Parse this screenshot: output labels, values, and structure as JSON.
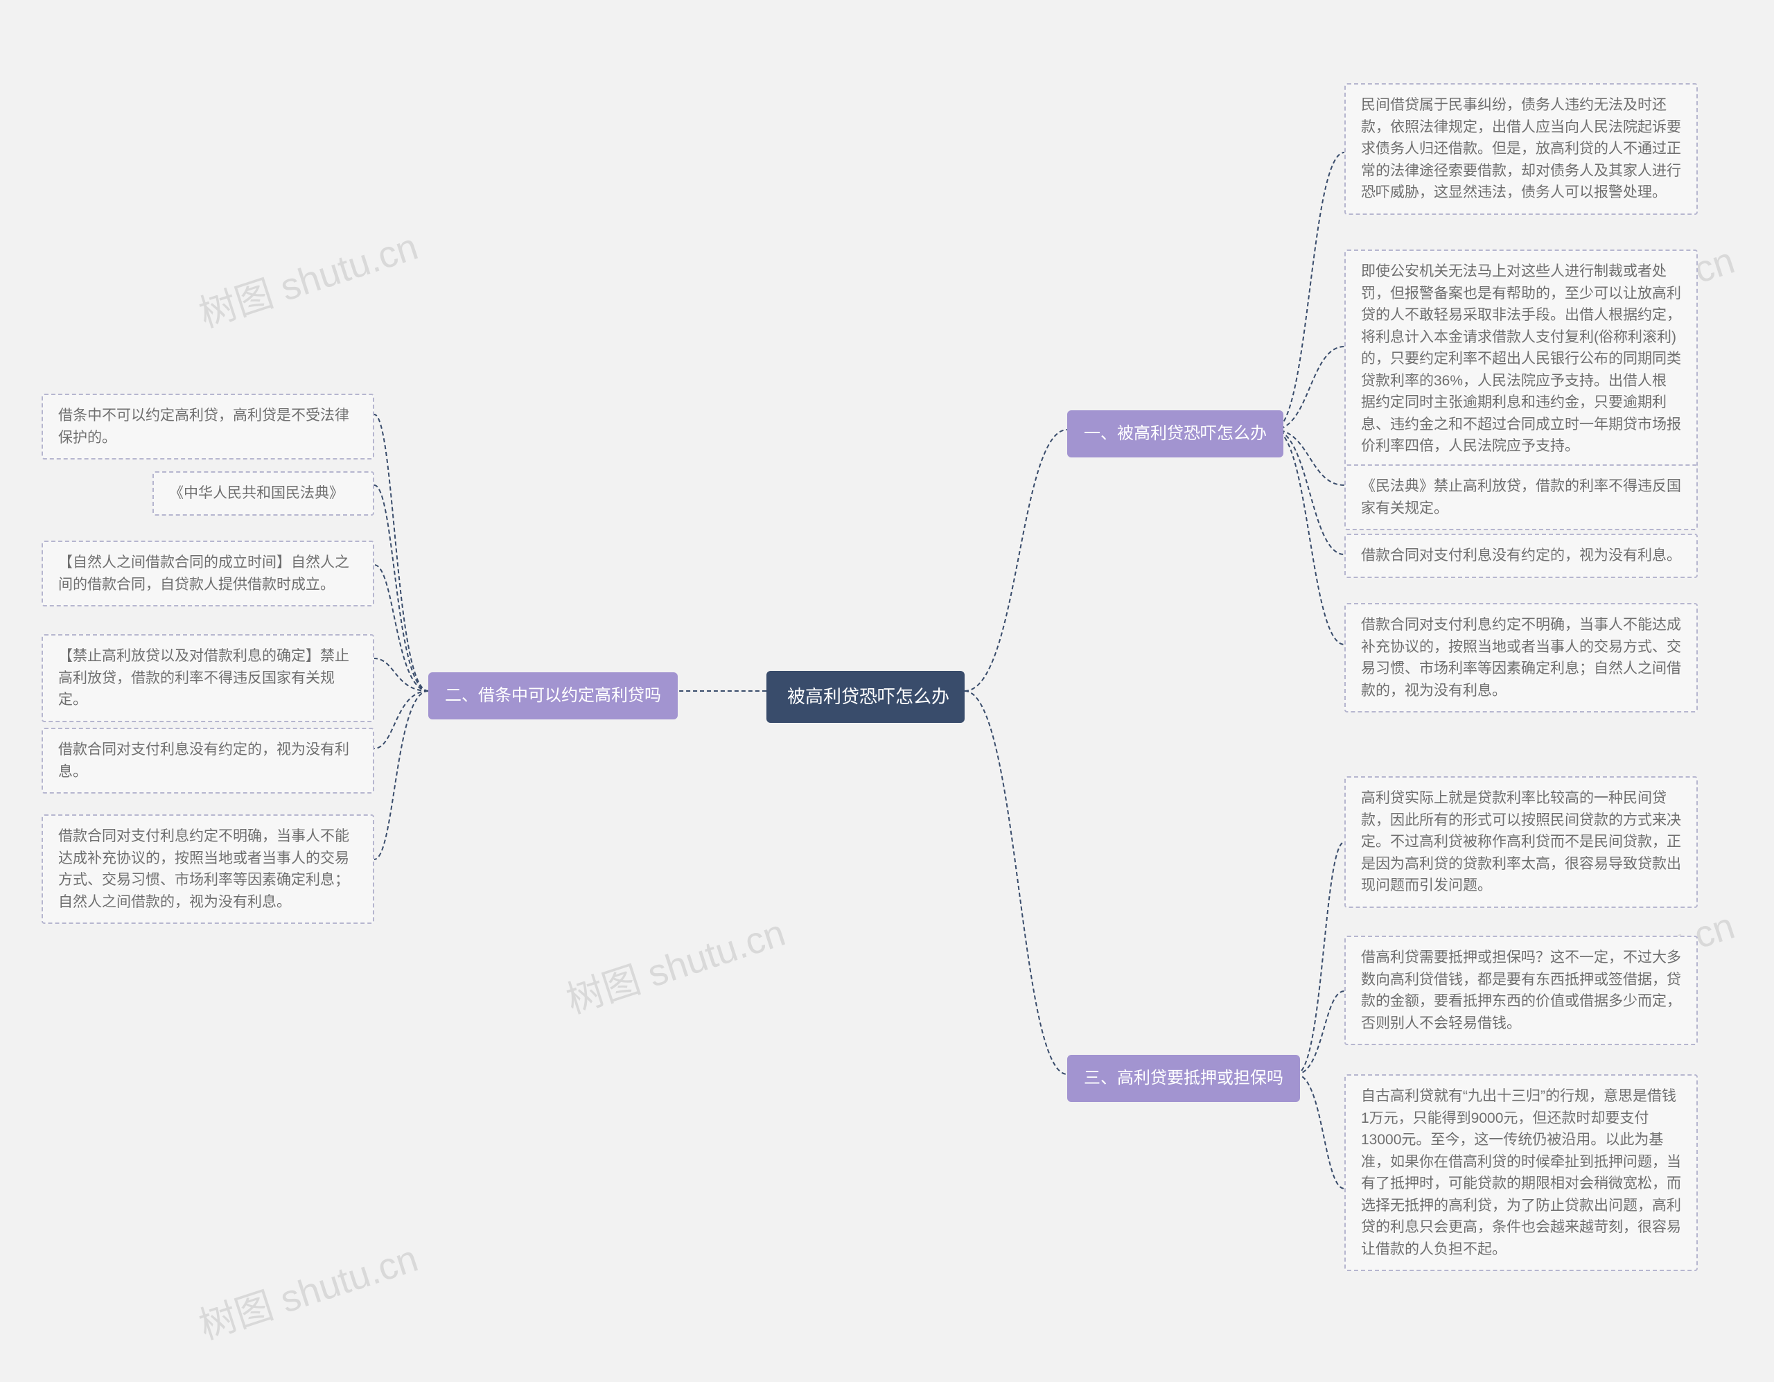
{
  "root": {
    "title": "被高利贷恐吓怎么办"
  },
  "branch1": {
    "title": "一、被高利贷恐吓怎么办",
    "leaves": [
      "民间借贷属于民事纠纷，债务人违约无法及时还款，依照法律规定，出借人应当向人民法院起诉要求债务人归还借款。但是，放高利贷的人不通过正常的法律途径索要借款，却对债务人及其家人进行恐吓威胁，这显然违法，债务人可以报警处理。",
      "即使公安机关无法马上对这些人进行制裁或者处罚，但报警备案也是有帮助的，至少可以让放高利贷的人不敢轻易采取非法手段。出借人根据约定，将利息计入本金请求借款人支付复利(俗称利滚利)的，只要约定利率不超出人民银行公布的同期同类贷款利率的36%，人民法院应予支持。出借人根据约定同时主张逾期利息和违约金，只要逾期利息、违约金之和不超过合同成立时一年期贷市场报价利率四倍，人民法院应予支持。",
      "《民法典》禁止高利放贷，借款的利率不得违反国家有关规定。",
      "借款合同对支付利息没有约定的，视为没有利息。",
      "借款合同对支付利息约定不明确，当事人不能达成补充协议的，按照当地或者当事人的交易方式、交易习惯、市场利率等因素确定利息；自然人之间借款的，视为没有利息。"
    ]
  },
  "branch2": {
    "title": "二、借条中可以约定高利贷吗",
    "leaves": [
      "借条中不可以约定高利贷，高利贷是不受法律保护的。",
      "《中华人民共和国民法典》",
      "【自然人之间借款合同的成立时间】自然人之间的借款合同，自贷款人提供借款时成立。",
      "【禁止高利放贷以及对借款利息的确定】禁止高利放贷，借款的利率不得违反国家有关规定。",
      "借款合同对支付利息没有约定的，视为没有利息。",
      "借款合同对支付利息约定不明确，当事人不能达成补充协议的，按照当地或者当事人的交易方式、交易习惯、市场利率等因素确定利息；自然人之间借款的，视为没有利息。"
    ]
  },
  "branch3": {
    "title": "三、高利贷要抵押或担保吗",
    "leaves": [
      "高利贷实际上就是贷款利率比较高的一种民间贷款，因此所有的形式可以按照民间贷款的方式来决定。不过高利贷被称作高利贷而不是民间贷款，正是因为高利贷的贷款利率太高，很容易导致贷款出现问题而引发问题。",
      "借高利贷需要抵押或担保吗？这不一定，不过大多数向高利贷借钱，都是要有东西抵押或签借据，贷款的金额，要看抵押东西的价值或借据多少而定，否则别人不会轻易借钱。",
      "自古高利贷就有“九出十三归”的行规，意思是借钱1万元，只能得到9000元，但还款时却要支付13000元。至今，这一传统仍被沿用。以此为基准，如果你在借高利贷的时候牵扯到抵押问题，当有了抵押时，可能贷款的期限相对会稍微宽松，而选择无抵押的高利贷，为了防止贷款出问题，高利贷的利息只会更高，条件也会越来越苛刻，很容易让借款的人负担不起。"
    ]
  },
  "watermark": "树图 shutu.cn"
}
